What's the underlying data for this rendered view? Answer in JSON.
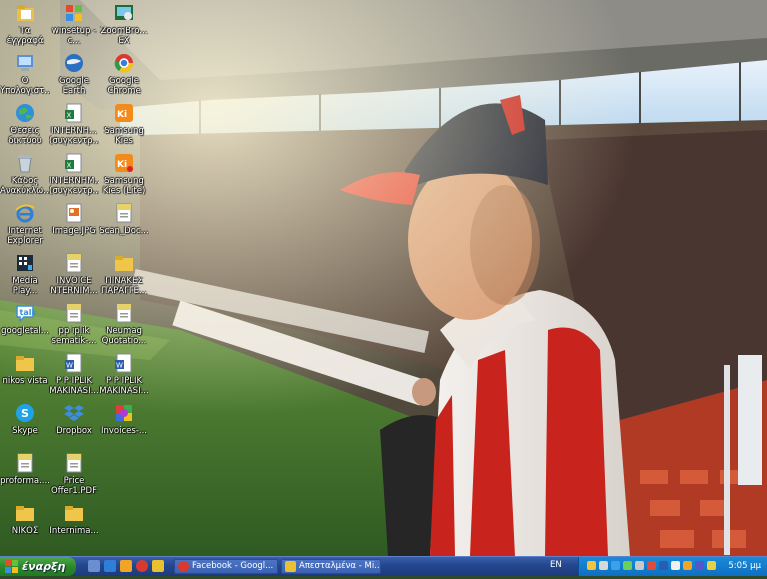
{
  "desktop": {
    "icons": [
      {
        "id": "my-documents",
        "label": "Τα έγγραφά\nμου",
        "icon": "folder-documents-icon"
      },
      {
        "id": "winsetup",
        "label": "winsetup -c...",
        "icon": "windows-flag-icon"
      },
      {
        "id": "zoombrowser",
        "label": "ZoomBro...\nEX",
        "icon": "zoombrowser-icon"
      },
      {
        "id": "my-computer",
        "label": "Ο\nΥπολογιστ...",
        "icon": "computer-icon"
      },
      {
        "id": "google-earth",
        "label": "Google\nEarth",
        "icon": "google-earth-icon"
      },
      {
        "id": "google-chrome",
        "label": "Google\nChrome",
        "icon": "chrome-icon"
      },
      {
        "id": "network-places",
        "label": "Θέσεις\nδικτύου",
        "icon": "network-globe-icon"
      },
      {
        "id": "internet-doc-1",
        "label": "INTERNH...\n(συγκεντρ...",
        "icon": "excel-file-icon"
      },
      {
        "id": "samsung-kies",
        "label": "Samsung\nKies",
        "icon": "samsung-kies-icon"
      },
      {
        "id": "recycle-bin",
        "label": "Κάδος\nΑνακύκλω...",
        "icon": "recycle-bin-icon"
      },
      {
        "id": "internet-doc-2",
        "label": "INTERNHM...\n(συγκεντρ...",
        "icon": "excel-file-icon"
      },
      {
        "id": "samsung-kies-lite",
        "label": "Samsung\nKies (Lite)",
        "icon": "samsung-kies-icon"
      },
      {
        "id": "internet-explorer",
        "label": "Internet\nExplorer",
        "icon": "internet-explorer-icon"
      },
      {
        "id": "image-jpg",
        "label": "Image.JPG",
        "icon": "image-file-icon"
      },
      {
        "id": "scan-doc",
        "label": "Scan_Doc...",
        "icon": "pdf-file-icon"
      },
      {
        "id": "media-player",
        "label": "Media\nPlay...",
        "icon": "media-player-icon"
      },
      {
        "id": "invoice-internim",
        "label": "INVOICE\nNTERNIM...",
        "icon": "pdf-file-icon"
      },
      {
        "id": "pinakes",
        "label": "ΠΙΝΑΚΕΣ\nΠΑΡΑΓΓΕ...",
        "icon": "folder-icon"
      },
      {
        "id": "googletalk",
        "label": "googletal...",
        "icon": "googletalk-icon"
      },
      {
        "id": "pp-iplik-sematik",
        "label": "pp iplik\nsematik-...",
        "icon": "pdf-file-icon"
      },
      {
        "id": "neumag-quotation",
        "label": "Neumag\nQuotatio...",
        "icon": "pdf-file-icon"
      },
      {
        "id": "nikos-vista",
        "label": "nikos vista",
        "icon": "folder-icon"
      },
      {
        "id": "pp-iplik-makinasi-1",
        "label": "P P IPLIK\nMAKINASI...",
        "icon": "word-file-icon"
      },
      {
        "id": "pp-iplik-makinasi-2",
        "label": "P P IPLIK\nMAKINASI...",
        "icon": "word-file-icon"
      },
      {
        "id": "skype",
        "label": "Skype",
        "icon": "skype-icon"
      },
      {
        "id": "dropbox",
        "label": "Dropbox",
        "icon": "dropbox-icon"
      },
      {
        "id": "invoices",
        "label": "Invoices-...",
        "icon": "invoices-app-icon"
      },
      {
        "id": "proforma",
        "label": "proforma....",
        "icon": "pdf-file-icon"
      },
      {
        "id": "price-offer",
        "label": "Price\nOffer1.PDF",
        "icon": "pdf-file-icon"
      },
      {
        "id": "nikos",
        "label": "ΝΙΚΟΣ",
        "icon": "folder-icon"
      },
      {
        "id": "internima",
        "label": "Internima...",
        "icon": "folder-icon"
      }
    ]
  },
  "taskbar": {
    "start_label": "έναρξη",
    "quick_launch": [
      "show-desktop-icon",
      "internet-explorer-icon",
      "media-player-icon",
      "chrome-icon",
      "outlook-icon"
    ],
    "tasks": [
      {
        "label": "Facebook - Googl...",
        "icon": "chrome-icon"
      },
      {
        "label": "Απεσταλμένα - Mi...",
        "icon": "outlook-icon"
      }
    ],
    "language": "EN",
    "clock": "5:05 μμ"
  },
  "colors": {
    "taskbar": "#24468e",
    "start": "#2c8a2a",
    "tray": "#0f6fc2"
  }
}
